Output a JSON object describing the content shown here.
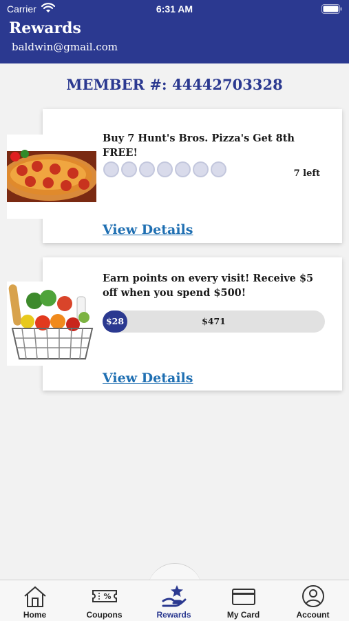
{
  "status_bar": {
    "carrier": "Carrier",
    "time": "6:31 AM"
  },
  "header": {
    "title": "Rewards",
    "email": "baldwin@gmail.com",
    "background_color": "#2b3990"
  },
  "member": {
    "label": "MEMBER #: 44442703328"
  },
  "rewards": [
    {
      "title": "Buy 7 Hunt's Bros. Pizza's Get 8th FREE!",
      "punches_total": 7,
      "punches_filled": 0,
      "remaining_text": "7 left",
      "link": "View Details",
      "image": "pizza-image"
    },
    {
      "title": "Earn points on every visit! Receive $5 off when you spend $500!",
      "earned_text": "$28",
      "remaining_text": "$471",
      "progress_fraction": 0.056,
      "link": "View Details",
      "image": "grocery-basket-image"
    }
  ],
  "tabs": [
    {
      "label": "Home",
      "icon": "home-icon",
      "active": false
    },
    {
      "label": "Coupons",
      "icon": "coupon-icon",
      "active": false
    },
    {
      "label": "Rewards",
      "icon": "rewards-icon",
      "active": true
    },
    {
      "label": "My Card",
      "icon": "card-icon",
      "active": false
    },
    {
      "label": "Account",
      "icon": "account-icon",
      "active": false
    }
  ],
  "colors": {
    "accent": "#2b3990",
    "link": "#1f6fb2"
  }
}
